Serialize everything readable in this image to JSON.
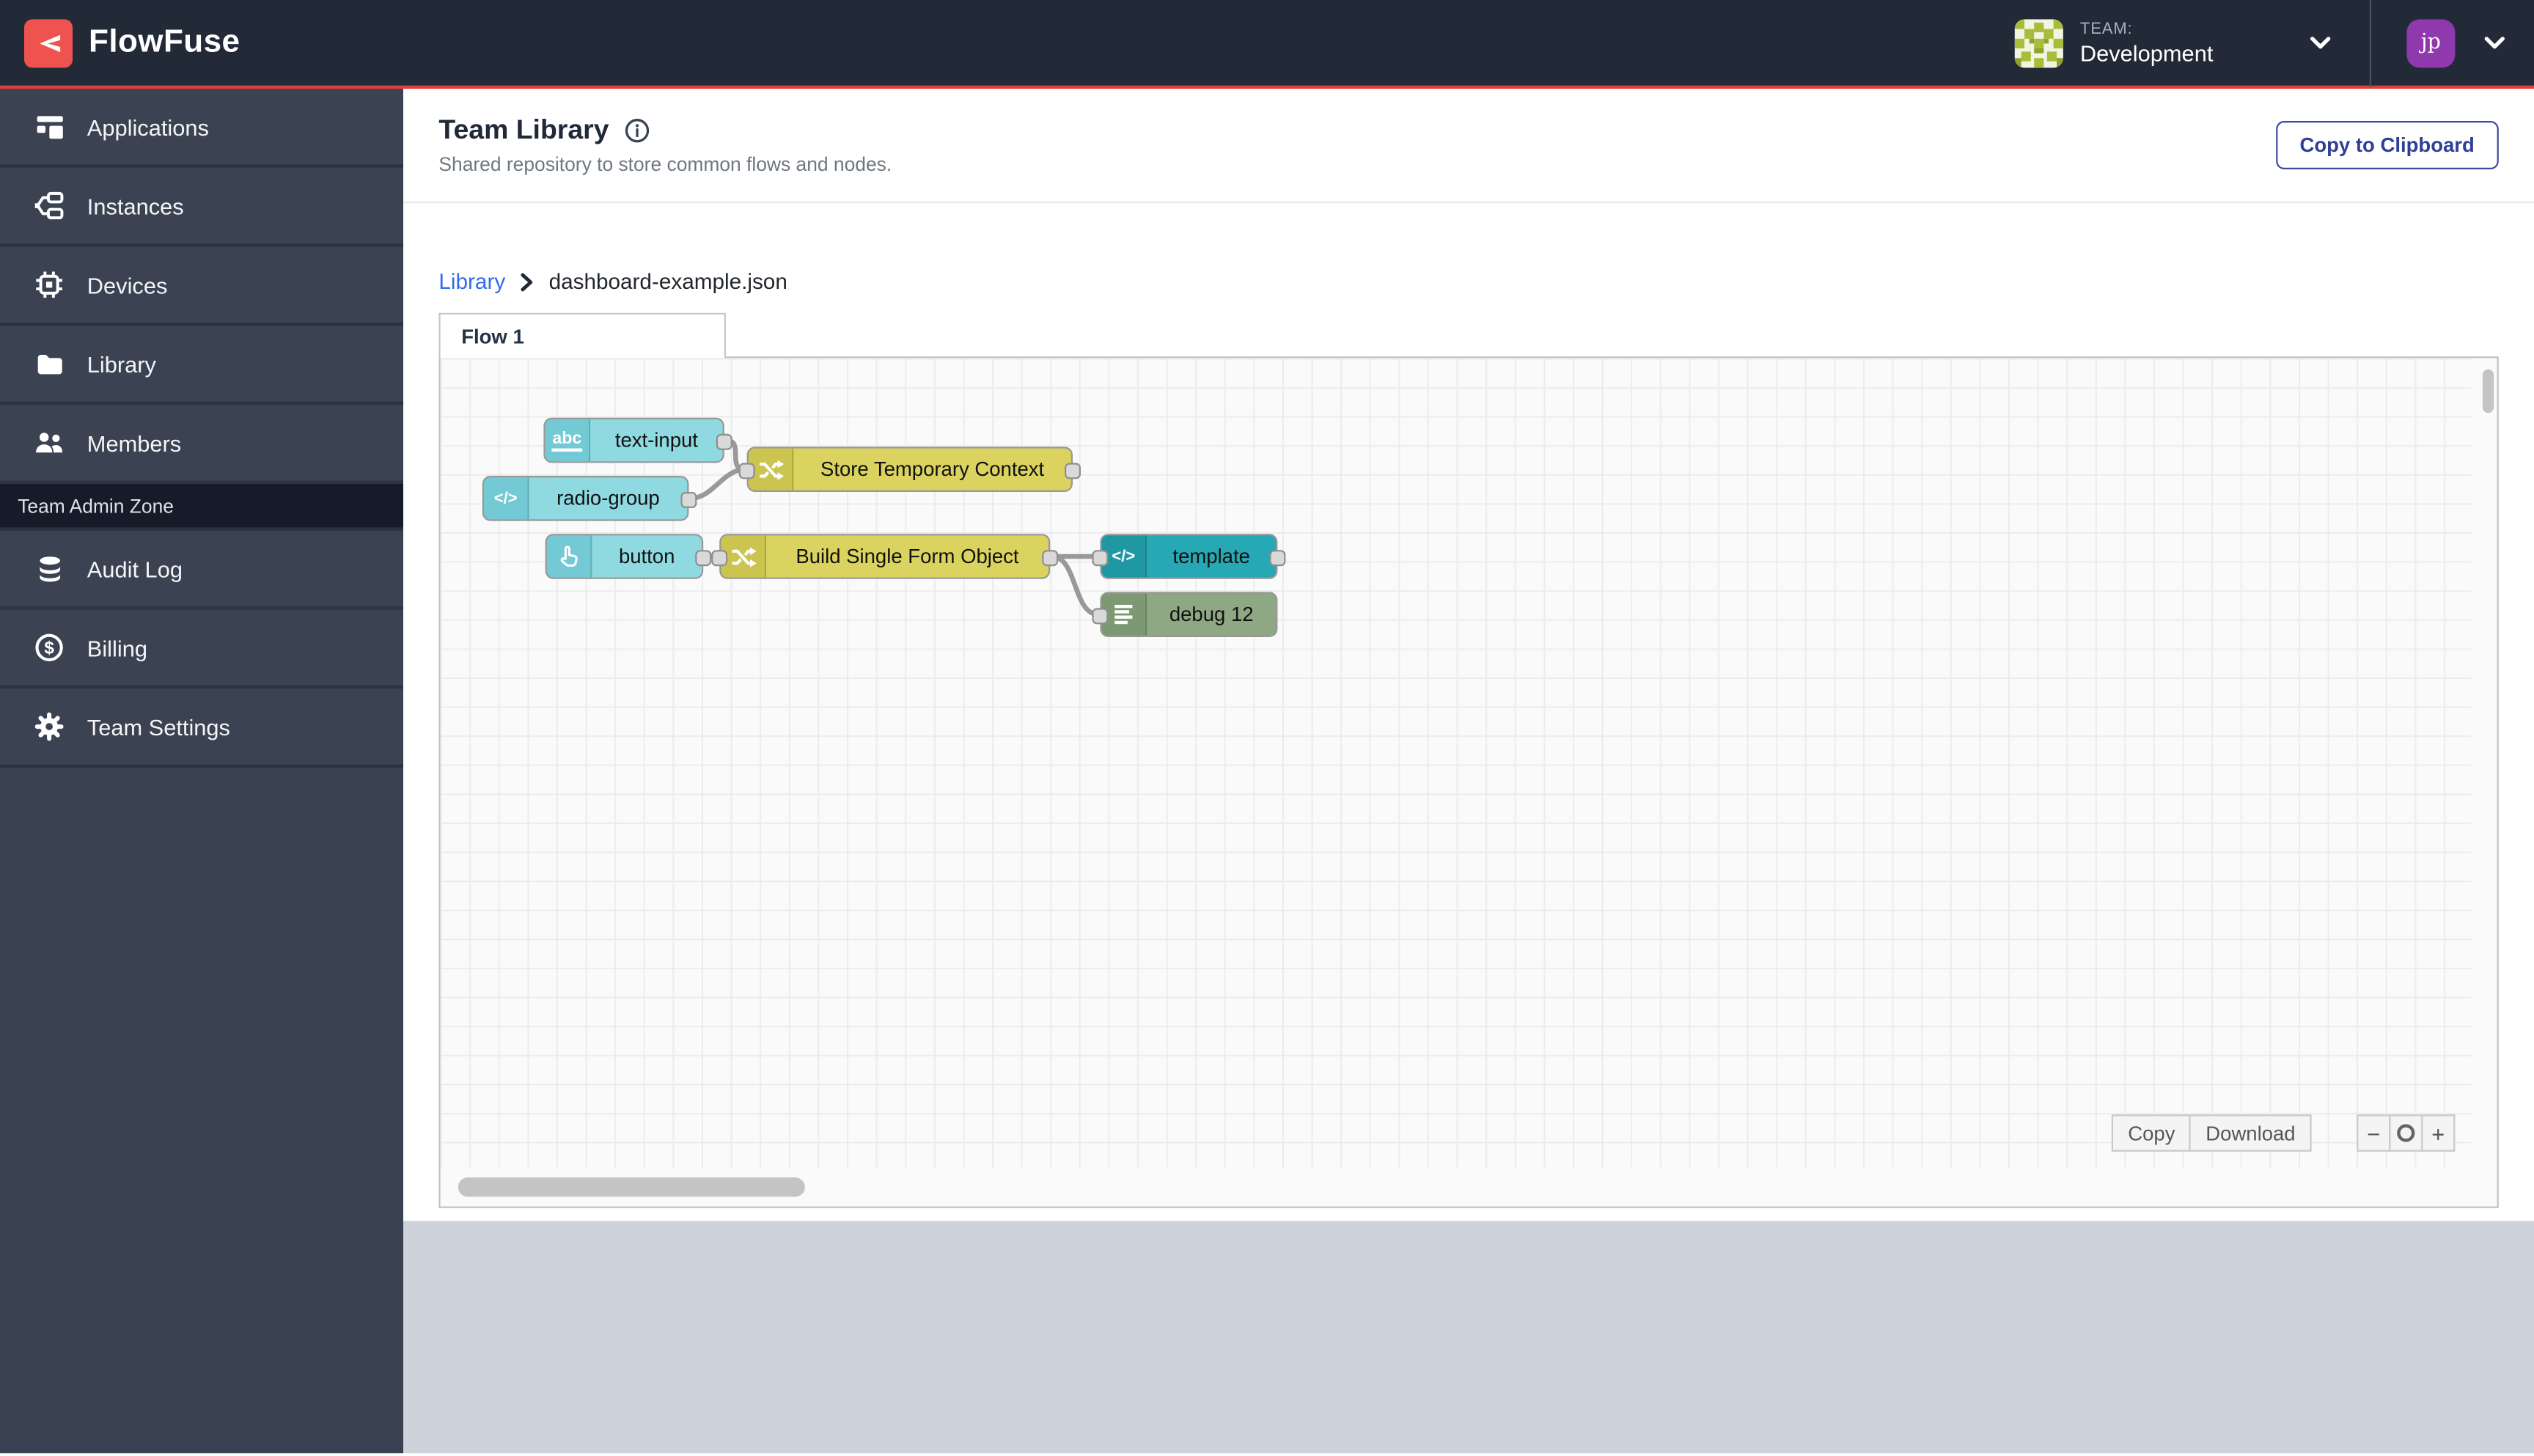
{
  "brand": {
    "name": "FlowFuse"
  },
  "topbar": {
    "team_label": "TEAM:",
    "team_name": "Development",
    "user_initials": "jp"
  },
  "sidebar": {
    "items": [
      {
        "label": "Applications",
        "icon": "applications-icon"
      },
      {
        "label": "Instances",
        "icon": "instances-icon"
      },
      {
        "label": "Devices",
        "icon": "devices-icon"
      },
      {
        "label": "Library",
        "icon": "library-icon"
      },
      {
        "label": "Members",
        "icon": "members-icon"
      }
    ],
    "admin_zone_label": "Team Admin Zone",
    "admin_items": [
      {
        "label": "Audit Log",
        "icon": "audit-log-icon"
      },
      {
        "label": "Billing",
        "icon": "billing-icon"
      },
      {
        "label": "Team Settings",
        "icon": "team-settings-icon"
      }
    ]
  },
  "page": {
    "title": "Team Library",
    "subtitle": "Shared repository to store common flows and nodes.",
    "copy_to_clipboard_label": "Copy to Clipboard"
  },
  "breadcrumb": {
    "root": "Library",
    "current": "dashboard-example.json"
  },
  "flow": {
    "tab_label": "Flow 1",
    "nodes": [
      {
        "label": "text-input",
        "type": "ui-text-input",
        "icon": "abc-icon",
        "icon_text": "abc",
        "color": "#8FD9E0"
      },
      {
        "label": "Store Temporary Context",
        "type": "change",
        "icon": "change-icon",
        "color": "#DAD35F"
      },
      {
        "label": "radio-group",
        "type": "ui-template",
        "icon": "code-icon",
        "icon_text": "</>",
        "color": "#8FD9E0"
      },
      {
        "label": "button",
        "type": "ui-button",
        "icon": "pointer-icon",
        "color": "#8FD9E0"
      },
      {
        "label": "Build Single Form Object",
        "type": "change",
        "icon": "change-icon",
        "color": "#DAD35F"
      },
      {
        "label": "template",
        "type": "template",
        "icon": "code-icon",
        "icon_text": "</>",
        "color": "#27A9B5"
      },
      {
        "label": "debug 12",
        "type": "debug",
        "icon": "debug-icon",
        "color": "#8EA884"
      }
    ],
    "controls": {
      "copy": "Copy",
      "download": "Download",
      "zoom_out": "−",
      "zoom_in": "+"
    }
  },
  "colors": {
    "brand_red": "#E23C3C",
    "logo_red": "#EF5350",
    "topnav_bg": "#222A38",
    "sidebar_bg": "#3A4251",
    "admin_zone_bg": "#151B29",
    "accent_indigo": "#2F3F96",
    "link_blue": "#2F6BEB",
    "avatar_purple": "#9038AE",
    "footer_gray": "#CED3DB"
  }
}
